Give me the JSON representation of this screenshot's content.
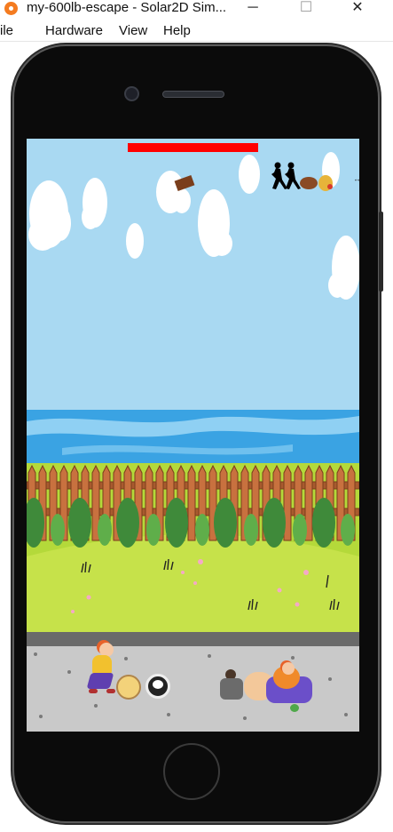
{
  "window": {
    "title": "my-600lb-escape - Solar2D Sim...",
    "minimize": "─",
    "maximize": "☐",
    "close": "✕"
  },
  "menu": [
    "ile",
    "Hardware",
    "View",
    "Help"
  ],
  "device": {
    "model_icon": "phone-frame-icon"
  },
  "game": {
    "health_fraction": 1.0,
    "health_color": "#ff0000",
    "sky_color": "#a9d9f2",
    "sea_color": "#3aa3e3",
    "fence_color": "#c8713f",
    "grass_color": "#b4d93a",
    "road_color": "#c9c9c9"
  }
}
